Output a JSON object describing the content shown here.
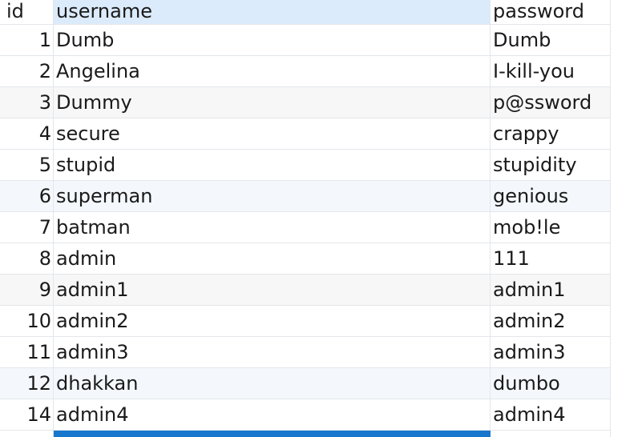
{
  "table": {
    "columns": {
      "id": "id",
      "username": "username",
      "password": "password"
    },
    "rows": [
      {
        "id": "1",
        "username": "Dumb",
        "password": "Dumb"
      },
      {
        "id": "2",
        "username": "Angelina",
        "password": "I-kill-you"
      },
      {
        "id": "3",
        "username": "Dummy",
        "password": "p@ssword"
      },
      {
        "id": "4",
        "username": "secure",
        "password": "crappy"
      },
      {
        "id": "5",
        "username": "stupid",
        "password": "stupidity"
      },
      {
        "id": "6",
        "username": "superman",
        "password": "genious"
      },
      {
        "id": "7",
        "username": "batman",
        "password": "mob!le"
      },
      {
        "id": "8",
        "username": "admin",
        "password": "111"
      },
      {
        "id": "9",
        "username": "admin1",
        "password": "admin1"
      },
      {
        "id": "10",
        "username": "admin2",
        "password": "admin2"
      },
      {
        "id": "11",
        "username": "admin3",
        "password": "admin3"
      },
      {
        "id": "12",
        "username": "dhakkan",
        "password": "dumbo"
      },
      {
        "id": "14",
        "username": "admin4",
        "password": "admin4"
      }
    ]
  },
  "colors": {
    "header_selected": "#dcebfb",
    "row_alt": "#f7f7f7",
    "row_tint": "#f4f8fd",
    "selection": "#1677cc",
    "grid_line": "#e3e6ea"
  }
}
